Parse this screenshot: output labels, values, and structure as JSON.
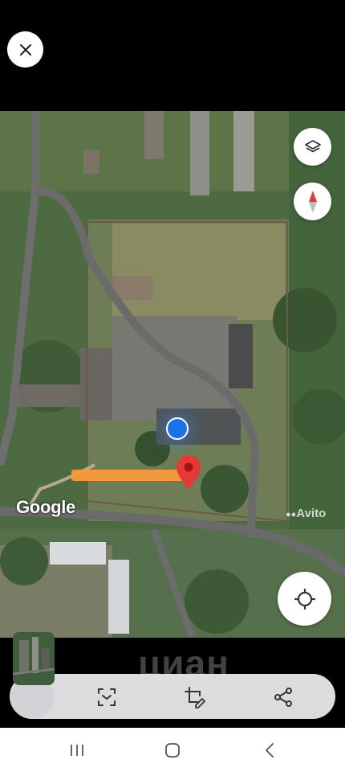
{
  "map": {
    "attribution": "Google",
    "watermark_avito": "Avito",
    "watermark_cian": "циан",
    "watermark_id": "ID: 303060779"
  },
  "colors": {
    "pin": "#e53935",
    "location_dot": "#1a73e8",
    "highlight_bar": "#ff9a3c",
    "compass_north": "#e53935"
  },
  "icons": {
    "close": "close-icon",
    "layers": "layers-icon",
    "compass": "compass-icon",
    "my_location": "crosshair-icon",
    "scan": "scan-icon",
    "edit": "crop-edit-icon",
    "share": "share-icon"
  },
  "system_nav": [
    "recents",
    "home",
    "back"
  ]
}
